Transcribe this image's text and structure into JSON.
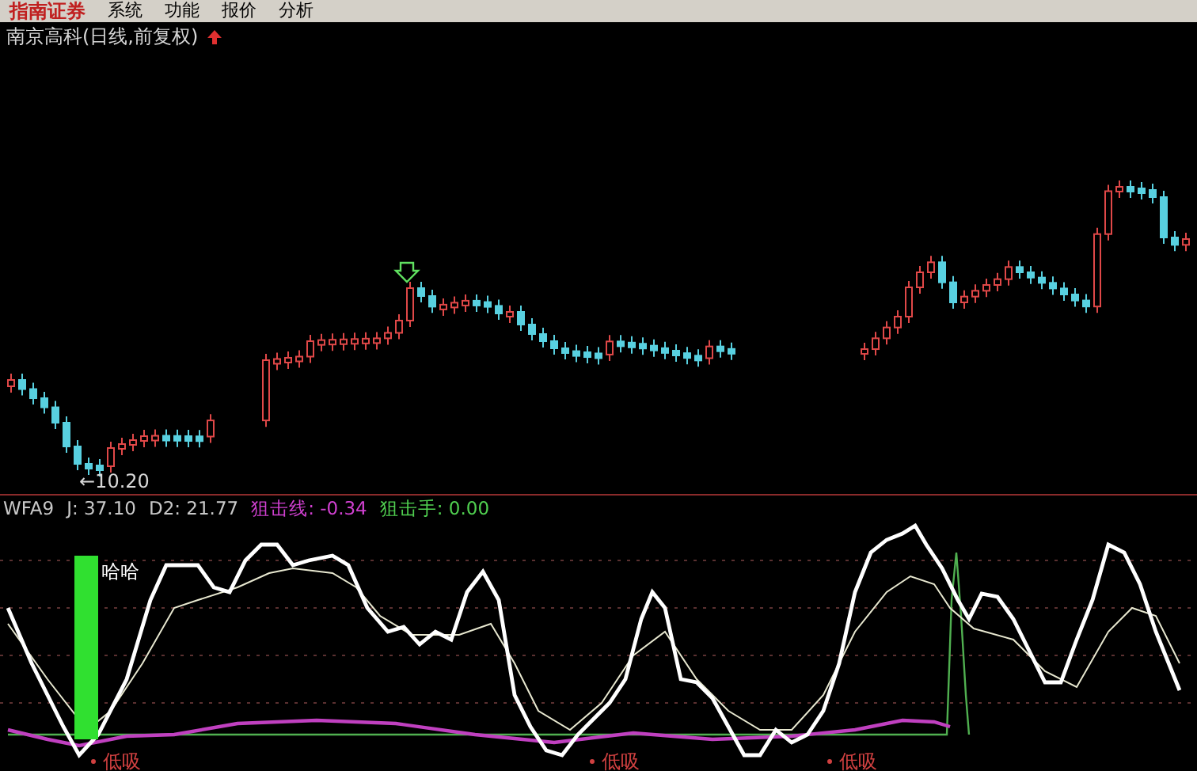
{
  "menu_bar": {
    "logo": "指南证券",
    "items": [
      "系统",
      "功能",
      "报价",
      "分析"
    ]
  },
  "stock_title": "南京高科(日线,前复权)",
  "price_chart": {
    "low_label": "←10.20"
  },
  "indicator": {
    "name": "WFA9",
    "readings": [
      {
        "text": "J: 37.10",
        "color": "#c8c8c8"
      },
      {
        "text": "D2: 21.77",
        "color": "#c8c8c8"
      },
      {
        "text": "狙击线: -0.34",
        "color": "#d040d0"
      },
      {
        "text": "狙击手: 0.00",
        "color": "#50d050"
      }
    ]
  },
  "signals": [
    {
      "kind": "top",
      "text": "哈哈"
    },
    {
      "kind": "buy",
      "text": "低吸"
    },
    {
      "kind": "buy",
      "text": "低吸"
    },
    {
      "kind": "buy",
      "text": "低吸"
    }
  ]
}
